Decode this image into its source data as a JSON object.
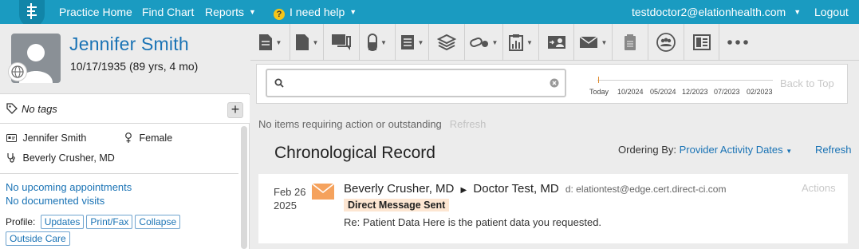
{
  "topnav": {
    "practice_home": "Practice Home",
    "find_chart": "Find Chart",
    "reports": "Reports",
    "help": "I need help",
    "user_email": "testdoctor2@elationhealth.com",
    "logout": "Logout",
    "brand_color": "#1a9bc1"
  },
  "patient": {
    "name": "Jennifer Smith",
    "dob": "10/17/1935 (89 yrs, 4 mo)",
    "tags_label": "No tags",
    "add_tag": "+",
    "card_name": "Jennifer Smith",
    "sex": "Female",
    "provider": "Beverly Crusher, MD",
    "appointments": "No upcoming appointments",
    "visits": "No documented visits",
    "profile_label": "Profile:",
    "profile_buttons": [
      "Updates",
      "Print/Fax",
      "Collapse",
      "Outside Care"
    ]
  },
  "toolbar": {
    "icons": [
      "document-icon",
      "page-icon",
      "chat-icon",
      "pill-icon",
      "list-icon",
      "layers-icon",
      "pills-icon",
      "chart-clipboard-icon",
      "contact-card-icon",
      "envelope-icon",
      "clipboard-icon",
      "group-icon",
      "layout-icon",
      "more-icon"
    ]
  },
  "search": {
    "placeholder": "",
    "timeline_labels": [
      "Today",
      "10/2024",
      "05/2024",
      "12/2023",
      "07/2023",
      "02/2023"
    ],
    "back_to_top": "Back to Top"
  },
  "record": {
    "outstanding": "No items requiring action or outstanding",
    "outstanding_refresh": "Refresh",
    "title": "Chronological Record",
    "ordering_label": "Ordering By:",
    "ordering_value": "Provider Activity Dates",
    "refresh": "Refresh"
  },
  "entries": [
    {
      "date_md": "Feb 26",
      "date_year": "2025",
      "from": "Beverly Crusher, MD",
      "to": "Doctor Test, MD",
      "direct_address": "d: elationtest@edge.cert.direct-ci.com",
      "badge": "Direct Message Sent",
      "body": "Re: Patient Data Here is the patient data you requested.",
      "actions": "Actions"
    }
  ]
}
